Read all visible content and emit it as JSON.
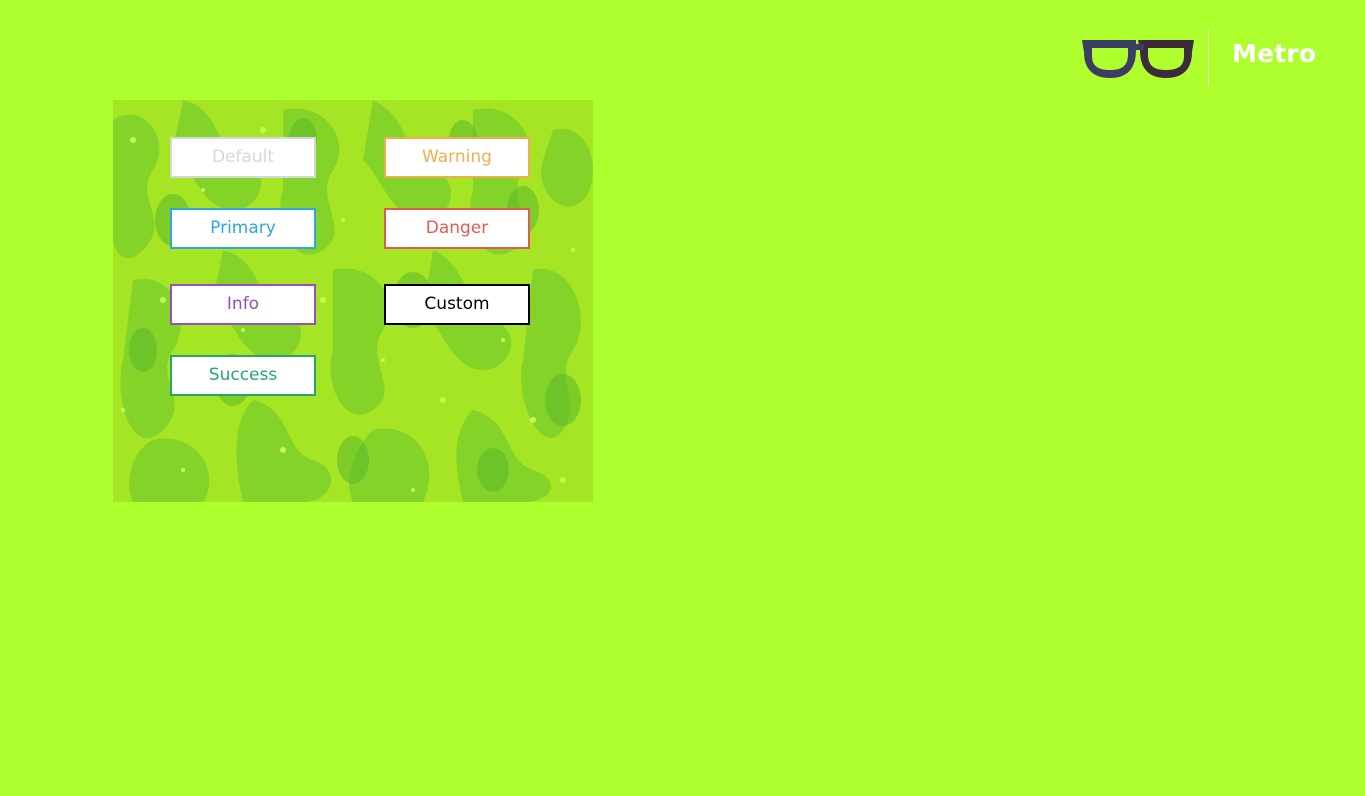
{
  "header": {
    "brand": "Metro",
    "logo_icon": "glasses-icon",
    "logo_colors": {
      "left_frame": "#3c3c64",
      "right_frame": "#3d2a3a"
    }
  },
  "panel": {
    "background_pattern": "green-blob-pattern",
    "buttons": [
      {
        "key": "default",
        "label": "Default",
        "border": "#d7d7d7",
        "text": "#d7d7d7"
      },
      {
        "key": "warning",
        "label": "Warning",
        "border": "#f0ad4e",
        "text": "#f0ad4e"
      },
      {
        "key": "primary",
        "label": "Primary",
        "border": "#2fa6df",
        "text": "#2fa6df"
      },
      {
        "key": "danger",
        "label": "Danger",
        "border": "#e05c4f",
        "text": "#e05c4f"
      },
      {
        "key": "info",
        "label": "Info",
        "border": "#9b4dbf",
        "text": "#9b4dbf"
      },
      {
        "key": "custom",
        "label": "Custom",
        "border": "#000000",
        "text": "#000000"
      },
      {
        "key": "success",
        "label": "Success",
        "border": "#22a86b",
        "text": "#22a86b"
      }
    ]
  },
  "colors": {
    "page_background": "#aeff2d",
    "panel_base": "#a6e524"
  }
}
